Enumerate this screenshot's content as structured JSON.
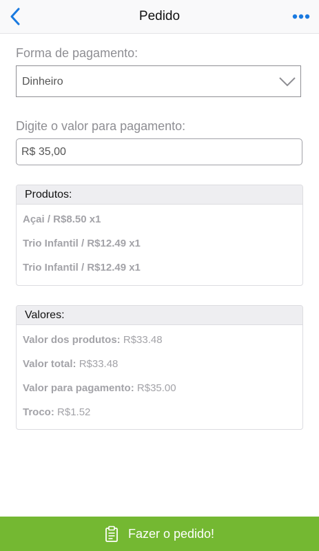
{
  "header": {
    "title": "Pedido",
    "back_icon": "chevron-left-icon",
    "more_icon": "more-horizontal-icon",
    "accent_color": "#1a7ae0"
  },
  "payment": {
    "label": "Forma de pagamento:",
    "selected": "Dinheiro"
  },
  "amount": {
    "label": "Digite o valor para pagamento:",
    "value": "R$ 35,00"
  },
  "products": {
    "title": "Produtos:",
    "items": [
      "Açai / R$8.50 x1",
      "Trio Infantil / R$12.49 x1",
      "Trio Infantil / R$12.49 x1"
    ]
  },
  "values": {
    "title": "Valores:",
    "rows": [
      {
        "label": "Valor dos produtos:",
        "value": "R$33.48"
      },
      {
        "label": "Valor total:",
        "value": "R$33.48"
      },
      {
        "label": "Valor para pagamento:",
        "value": "R$35.00"
      },
      {
        "label": "Troco:",
        "value": "R$1.52"
      }
    ]
  },
  "footer": {
    "button_label": "Fazer o pedido!",
    "icon": "clipboard-icon",
    "color": "#74b832"
  }
}
